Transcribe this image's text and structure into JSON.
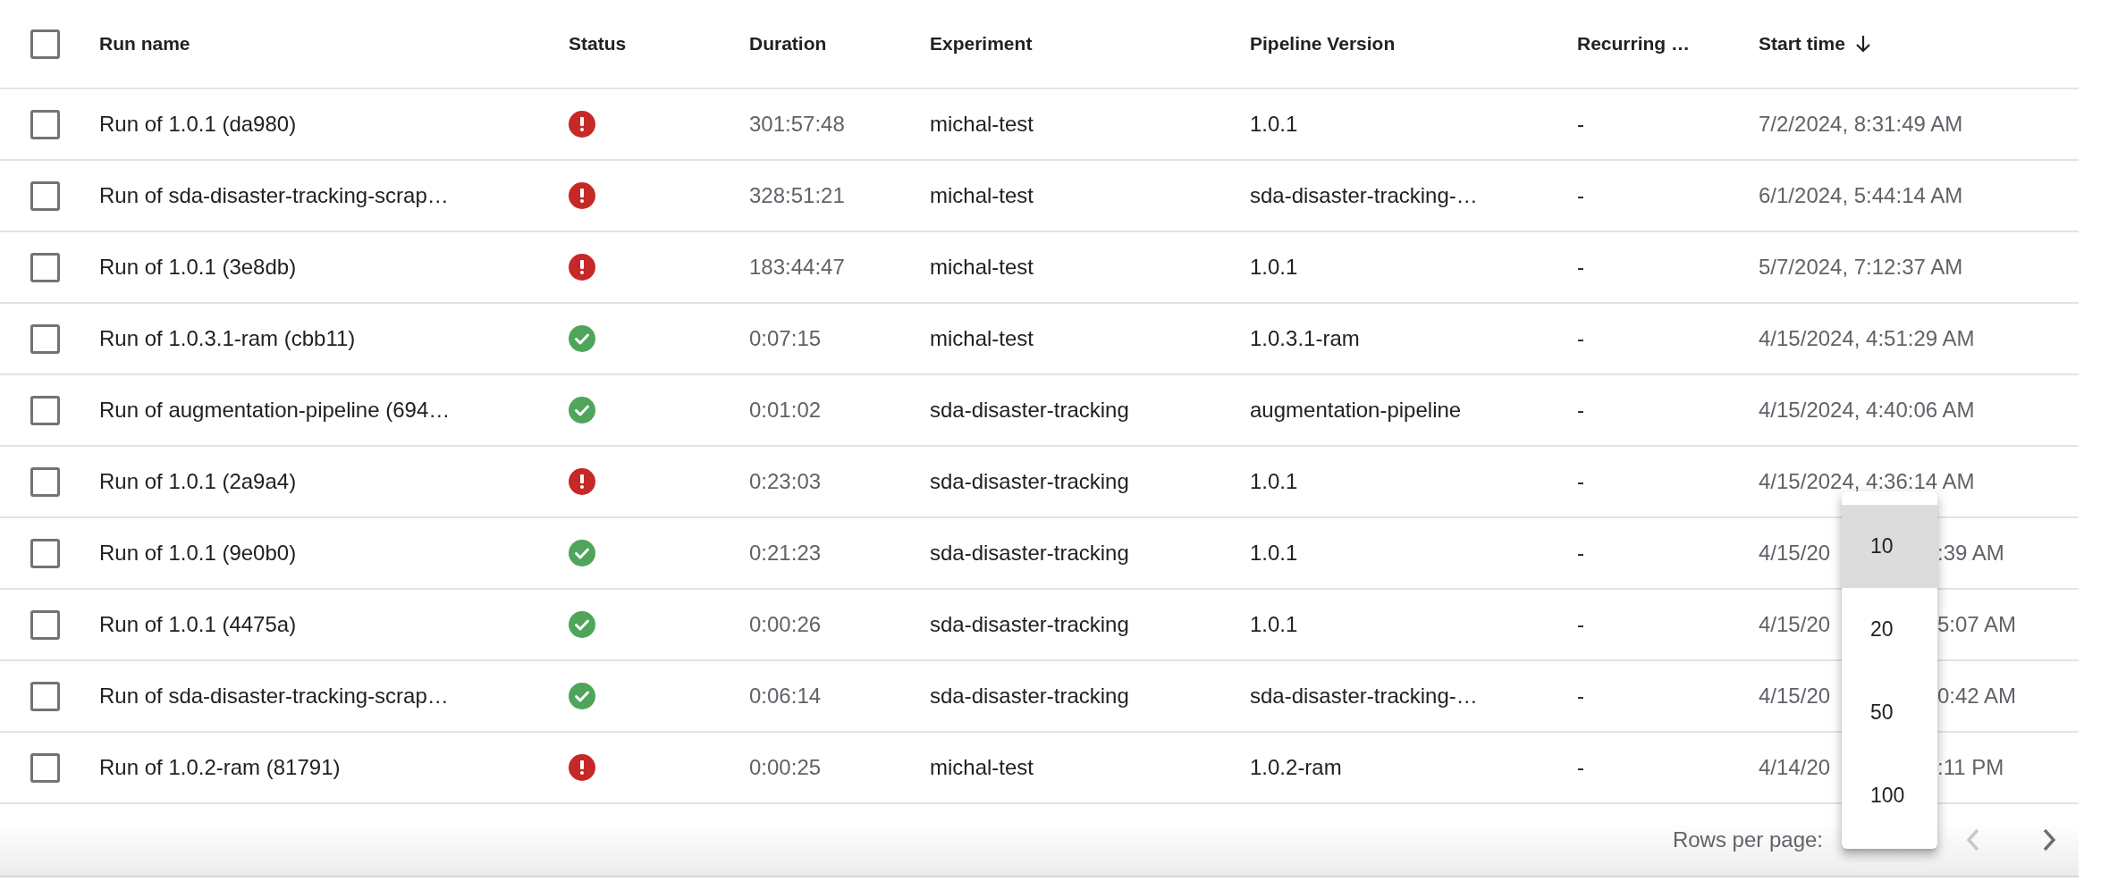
{
  "table": {
    "select_all": {
      "checked": false
    },
    "columns": [
      {
        "label": "Run name",
        "sorted": false
      },
      {
        "label": "Status",
        "sorted": false
      },
      {
        "label": "Duration",
        "sorted": false
      },
      {
        "label": "Experiment",
        "sorted": false
      },
      {
        "label": "Pipeline Version",
        "sorted": false
      },
      {
        "label": "Recurring …",
        "sorted": false
      },
      {
        "label": "Start time",
        "sorted": true
      }
    ],
    "rows": [
      {
        "checked": false,
        "run_name": "Run of 1.0.1 (da980)",
        "kind": "error",
        "duration": "301:57:48",
        "experiment": "michal-test",
        "pipeline_version": "1.0.1",
        "recurring": "-",
        "start_time_parts": [
          "7/2/2024, 8:31:49 AM"
        ]
      },
      {
        "checked": false,
        "run_name": "Run of sda-disaster-tracking-scrap…",
        "kind": "error",
        "duration": "328:51:21",
        "experiment": "michal-test",
        "pipeline_version": "sda-disaster-tracking-…",
        "recurring": "-",
        "start_time_parts": [
          "6/1/2024, 5:44:14 AM"
        ]
      },
      {
        "checked": false,
        "run_name": "Run of 1.0.1 (3e8db)",
        "kind": "error",
        "duration": "183:44:47",
        "experiment": "michal-test",
        "pipeline_version": "1.0.1",
        "recurring": "-",
        "start_time_parts": [
          "5/7/2024, 7:12:37 AM"
        ]
      },
      {
        "checked": false,
        "run_name": "Run of 1.0.3.1-ram (cbb11)",
        "kind": "success",
        "duration": "0:07:15",
        "experiment": "michal-test",
        "pipeline_version": "1.0.3.1-ram",
        "recurring": "-",
        "start_time_parts": [
          "4/15/2024, 4:51:29 AM"
        ]
      },
      {
        "checked": false,
        "run_name": "Run of augmentation-pipeline (694…",
        "kind": "success",
        "duration": "0:01:02",
        "experiment": "sda-disaster-tracking",
        "pipeline_version": "augmentation-pipeline",
        "recurring": "-",
        "start_time_parts": [
          "4/15/2024, 4:40:06 AM"
        ]
      },
      {
        "checked": false,
        "run_name": "Run of 1.0.1 (2a9a4)",
        "kind": "error",
        "duration": "0:23:03",
        "experiment": "sda-disaster-tracking",
        "pipeline_version": "1.0.1",
        "recurring": "-",
        "start_time_parts": [
          "4/15/2024, 4:36:14 AM"
        ]
      },
      {
        "checked": false,
        "run_name": "Run of 1.0.1 (9e0b0)",
        "kind": "success",
        "duration": "0:21:23",
        "experiment": "sda-disaster-tracking",
        "pipeline_version": "1.0.1",
        "recurring": "-",
        "start_time_parts": [
          "4/15/20",
          ":39 AM"
        ]
      },
      {
        "checked": false,
        "run_name": "Run of 1.0.1 (4475a)",
        "kind": "success",
        "duration": "0:00:26",
        "experiment": "sda-disaster-tracking",
        "pipeline_version": "1.0.1",
        "recurring": "-",
        "start_time_parts": [
          "4/15/20",
          "5:07 AM"
        ]
      },
      {
        "checked": false,
        "run_name": "Run of sda-disaster-tracking-scrap…",
        "kind": "success",
        "duration": "0:06:14",
        "experiment": "sda-disaster-tracking",
        "pipeline_version": "sda-disaster-tracking-…",
        "recurring": "-",
        "start_time_parts": [
          "4/15/20",
          "0:42 AM"
        ]
      },
      {
        "checked": false,
        "run_name": "Run of 1.0.2-ram (81791)",
        "kind": "error",
        "duration": "0:00:25",
        "experiment": "michal-test",
        "pipeline_version": "1.0.2-ram",
        "recurring": "-",
        "start_time_parts": [
          "4/14/20",
          ":11 PM"
        ]
      }
    ]
  },
  "footer": {
    "rows_per_page_label": "Rows per page:",
    "previous": {
      "disabled": true
    },
    "next": {
      "disabled": false
    }
  },
  "rows_per_page_menu": {
    "options": [
      {
        "label": "10",
        "selected": true
      },
      {
        "label": "20",
        "selected": false
      },
      {
        "label": "50",
        "selected": false
      },
      {
        "label": "100",
        "selected": false
      }
    ]
  }
}
